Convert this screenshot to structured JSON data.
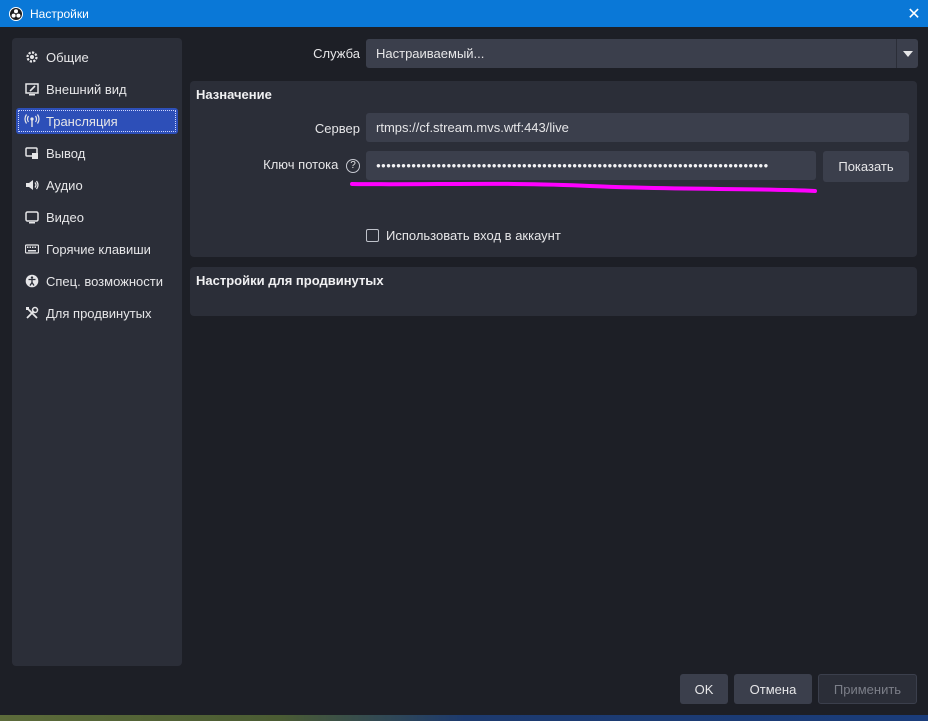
{
  "window": {
    "title": "Настройки",
    "close_glyph": "✕"
  },
  "sidebar": {
    "items": [
      {
        "label": "Общие",
        "icon": "gear-icon",
        "active": false
      },
      {
        "label": "Внешний вид",
        "icon": "appearance-icon",
        "active": false
      },
      {
        "label": "Трансляция",
        "icon": "broadcast-icon",
        "active": true
      },
      {
        "label": "Вывод",
        "icon": "output-icon",
        "active": false
      },
      {
        "label": "Аудио",
        "icon": "speaker-icon",
        "active": false
      },
      {
        "label": "Видео",
        "icon": "monitor-icon",
        "active": false
      },
      {
        "label": "Горячие клавиши",
        "icon": "keyboard-icon",
        "active": false
      },
      {
        "label": "Спец. возможности",
        "icon": "accessibility-icon",
        "active": false
      },
      {
        "label": "Для продвинутых",
        "icon": "tools-icon",
        "active": false
      }
    ]
  },
  "service": {
    "label": "Служба",
    "value": "Настраиваемый..."
  },
  "destination": {
    "title": "Назначение",
    "server_label": "Сервер",
    "server_value": "rtmps://cf.stream.mvs.wtf:443/live",
    "key_label": "Ключ потока",
    "key_help": "?",
    "key_value": "●●●●●●●●●●●●●●●●●●●●●●●●●●●●●●●●●●●●●●●●●●●●●●●●●●●●●●●●●●●●●●●●●●●●●●●●●●●●●●",
    "show_button": "Показать",
    "account_checkbox_label": "Использовать вход в аккаунт",
    "account_checked": false
  },
  "advanced": {
    "title": "Настройки для продвинутых"
  },
  "footer": {
    "ok": "OK",
    "cancel": "Отмена",
    "apply": "Применить"
  },
  "colors": {
    "titlebar": "#0a78d7",
    "active_item": "#2d4fb8",
    "annotation_stroke": "#ff00ff"
  }
}
